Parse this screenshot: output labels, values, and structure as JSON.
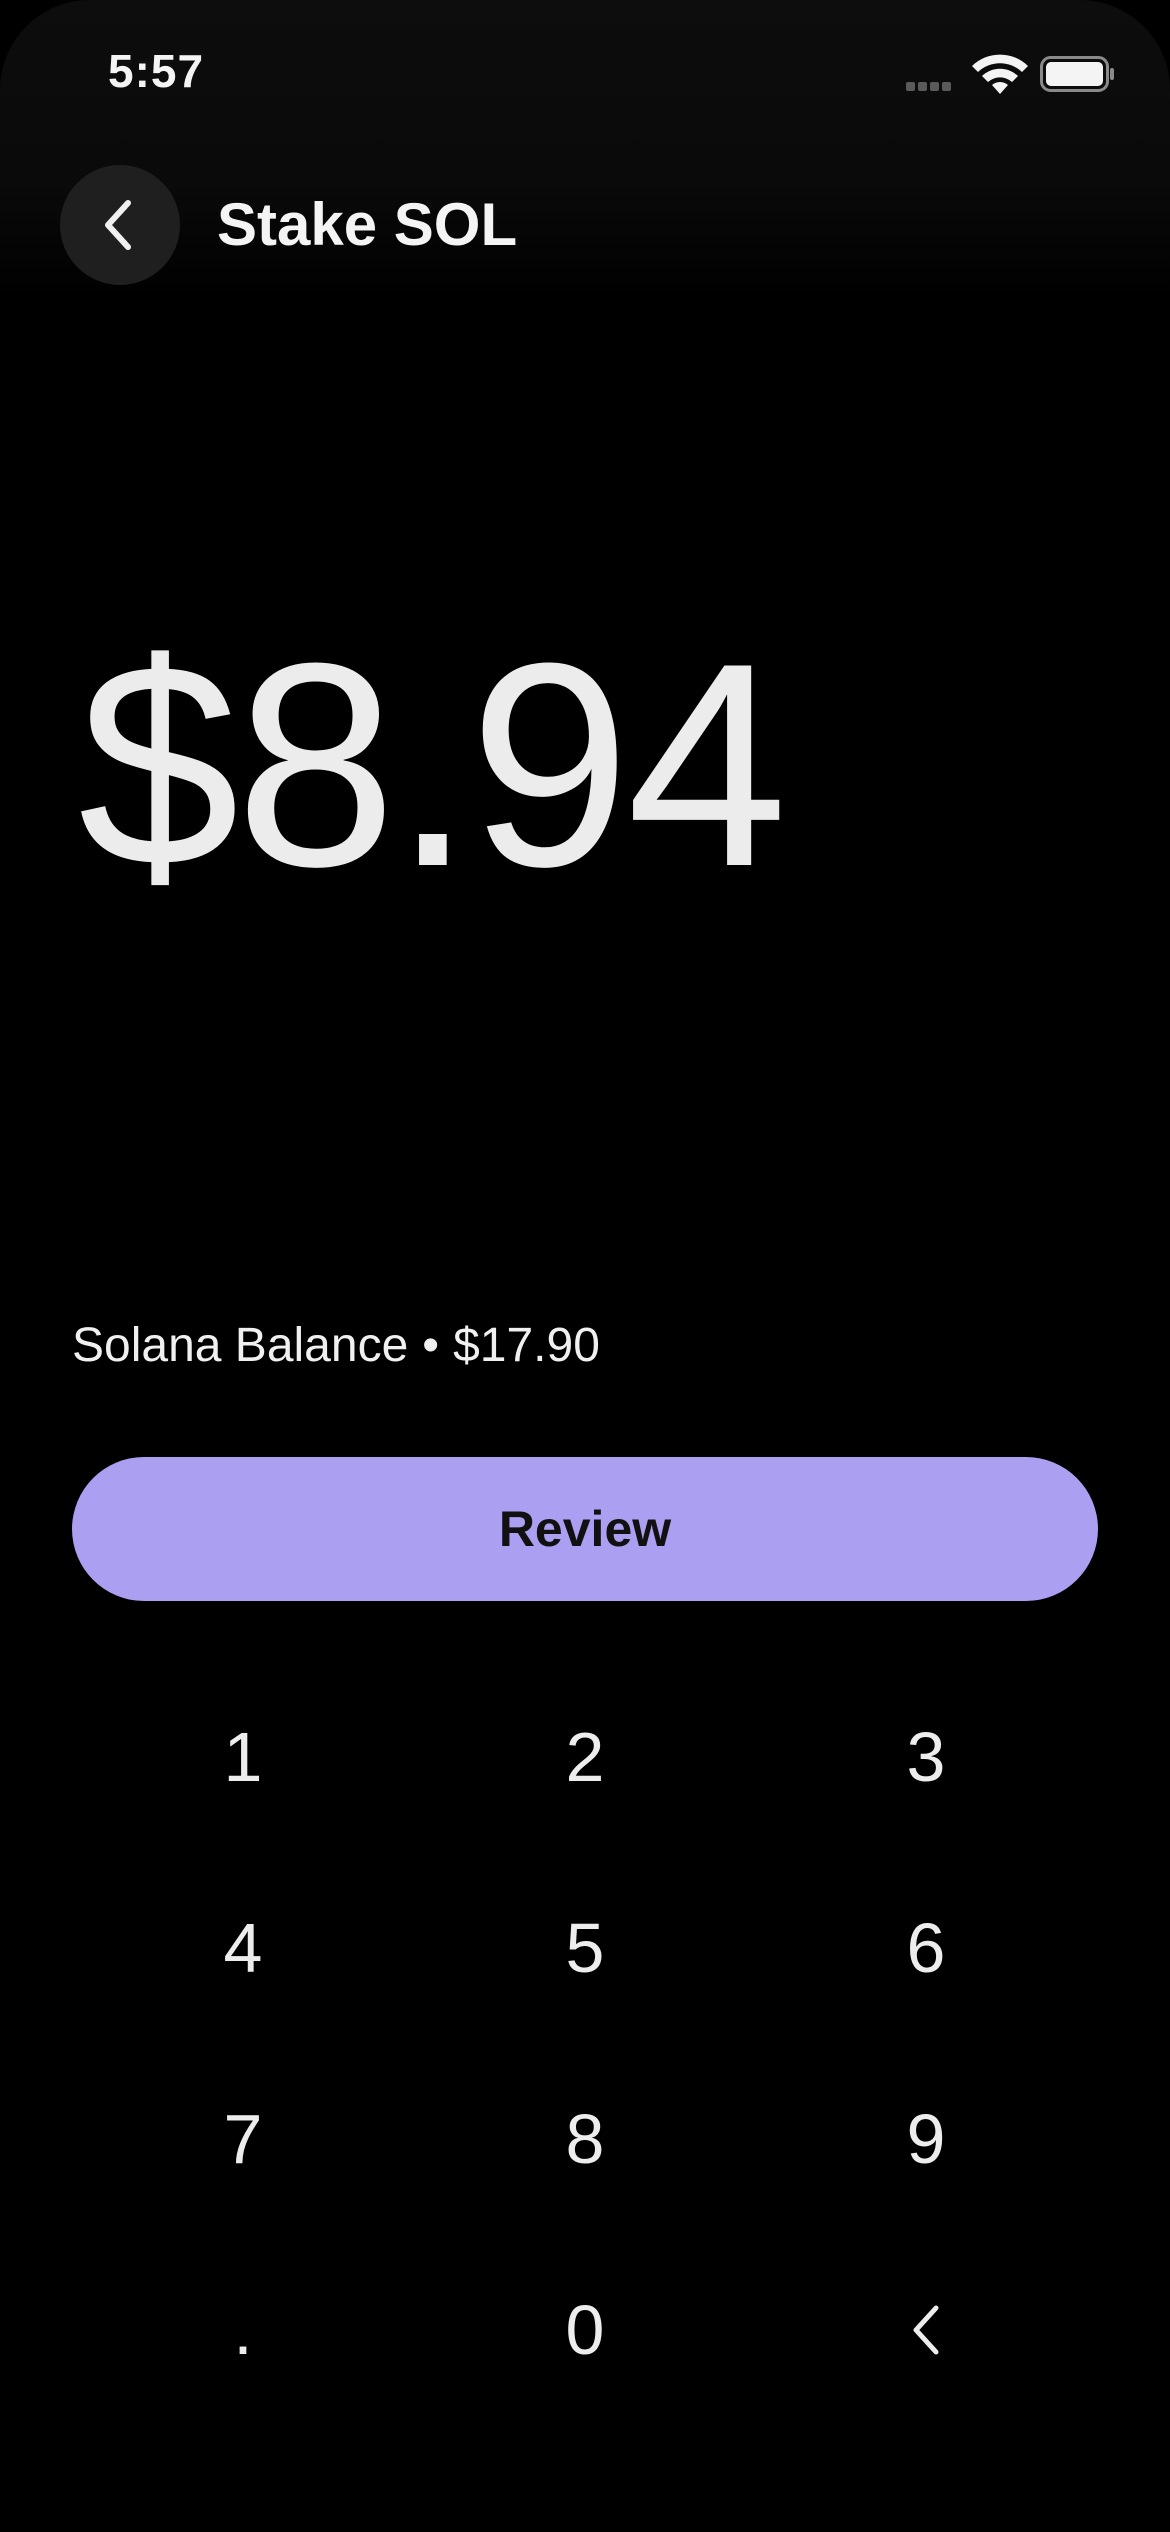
{
  "status_bar": {
    "time": "5:57",
    "icons": [
      "signal-icon",
      "wifi-icon",
      "battery-icon"
    ]
  },
  "header": {
    "back_icon": "chevron-left-icon",
    "title": "Stake SOL"
  },
  "amount": {
    "display": "$8.94"
  },
  "balance": {
    "label": "Solana Balance",
    "separator": "•",
    "value": "$17.90"
  },
  "review": {
    "label": "Review",
    "color": "#ab9ff2"
  },
  "keypad": {
    "keys": [
      "1",
      "2",
      "3",
      "4",
      "5",
      "6",
      "7",
      "8",
      "9",
      ".",
      "0"
    ],
    "backspace_icon": "chevron-left-icon"
  },
  "colors": {
    "background": "#000000",
    "accent": "#ab9ff2",
    "text": "#f2f2f2"
  }
}
